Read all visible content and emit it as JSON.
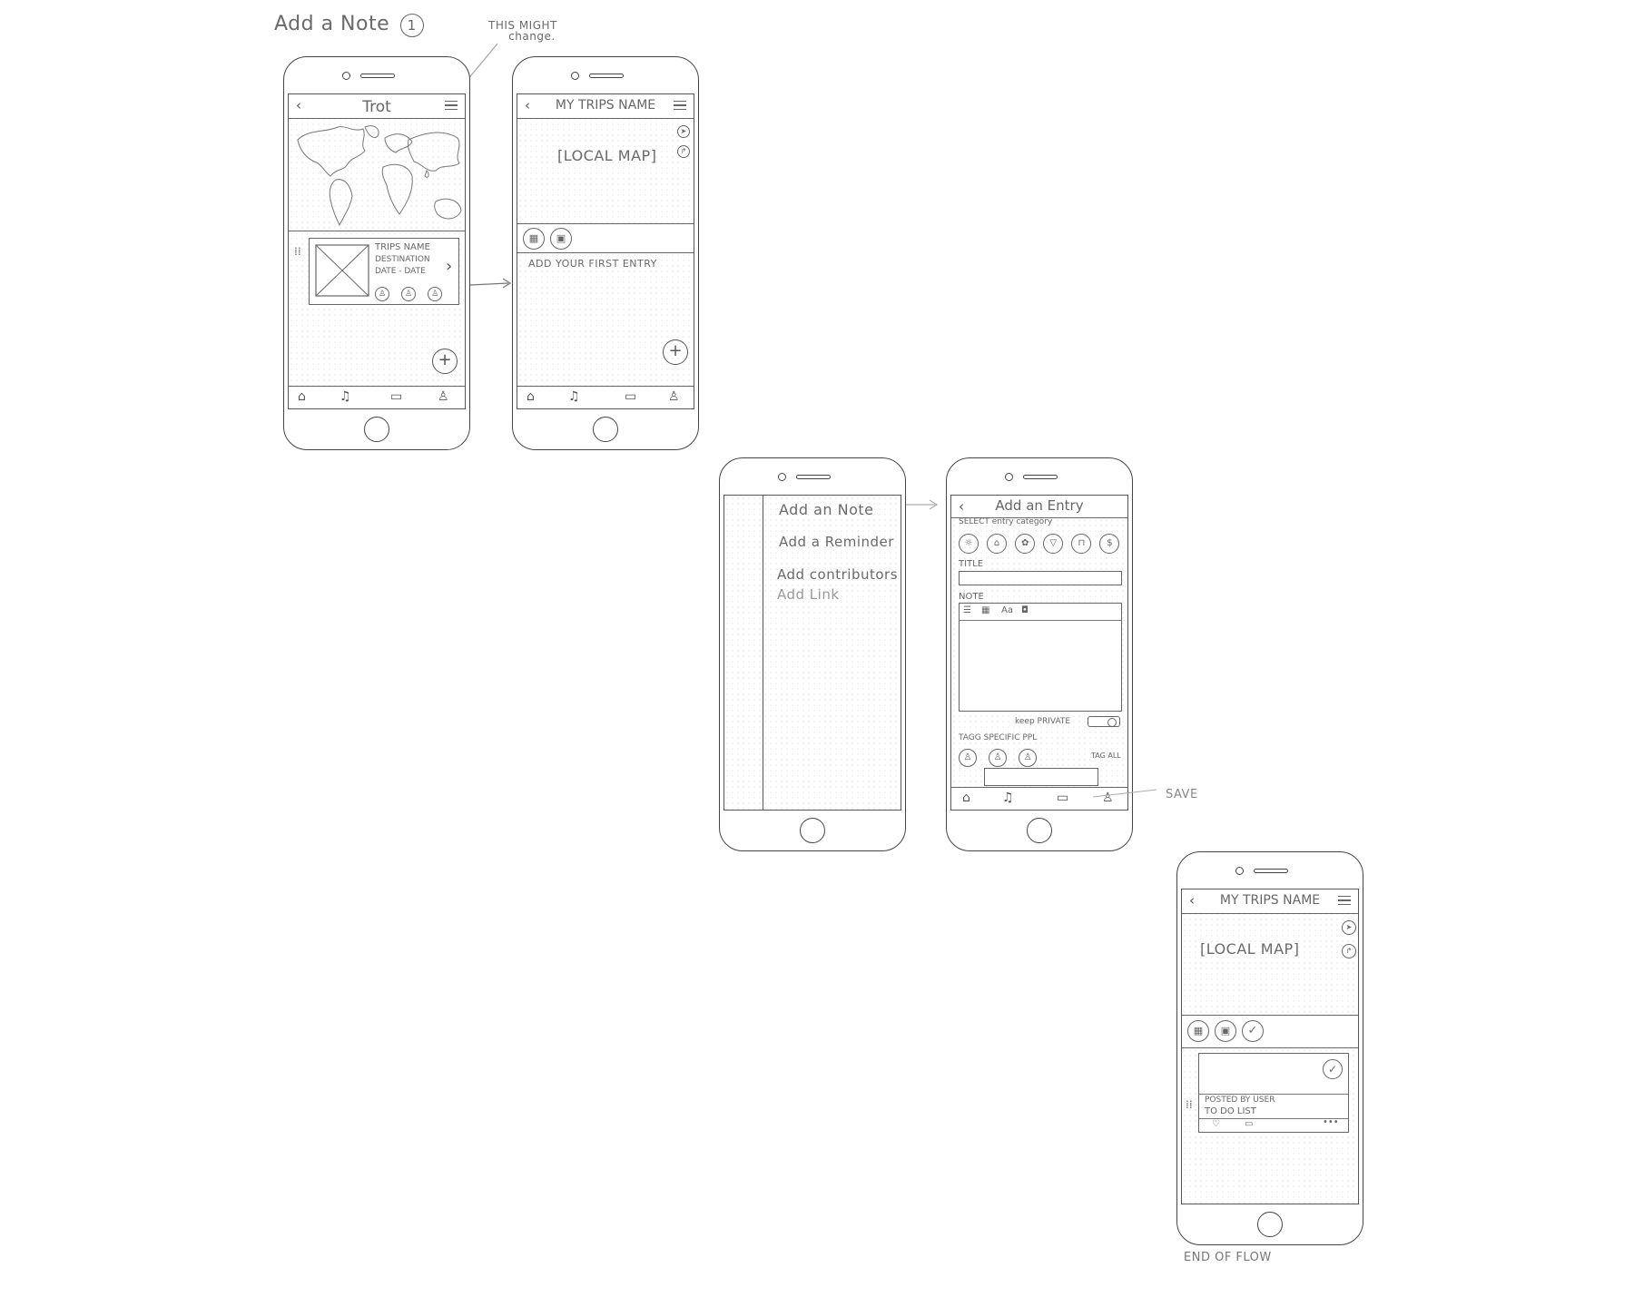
{
  "annotations": {
    "page_title": "Add a Note",
    "page_number": "1",
    "might_change_line1": "THIS MIGHT",
    "might_change_line2": "change.",
    "save_note": "SAVE",
    "end_note": "END OF FLOW"
  },
  "screen1": {
    "app_title": "Trot",
    "trip_name": "TRIPS NAME",
    "destination": "DESTINATION",
    "dates": "DATE - DATE"
  },
  "screen2": {
    "title": "MY TRIPS NAME",
    "map_label": "[LOCAL MAP]",
    "empty_prompt": "ADD YOUR FIRST ENTRY"
  },
  "screen3": {
    "menu_items": [
      "Add an Note",
      "Add a Reminder",
      "Add contributors",
      "Add Link"
    ]
  },
  "screen4": {
    "title": "Add an Entry",
    "category_label": "SELECT entry category",
    "title_label": "TITLE",
    "note_label": "NOTE",
    "format_text": "Aa",
    "keep_private": "keep PRIVATE",
    "tag_label": "TAGG SPECIFIC PPL",
    "tag_all": "TAG ALL"
  },
  "screen5": {
    "title": "MY TRIPS NAME",
    "map_label": "[LOCAL MAP]",
    "posted_by": "POSTED BY USER",
    "entry_title": "TO DO LIST",
    "more": "•••"
  },
  "colors": {
    "stroke": "#444444",
    "pencil": "#6a6a6a",
    "dots": "#d6d6d6"
  }
}
